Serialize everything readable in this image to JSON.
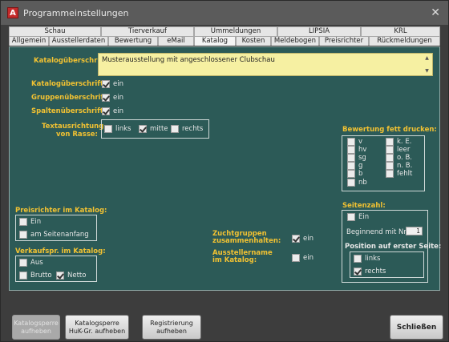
{
  "window": {
    "title": "Programmeinstellungen",
    "app_icon": "A"
  },
  "tabs_row1": [
    "Schau",
    "Tierverkauf",
    "Ummeldungen",
    "LIPSIA",
    "KRL"
  ],
  "tabs_row2": [
    "Allgemein",
    "Ausstellerdaten",
    "Bewertung",
    "eMail",
    "Katalog",
    "Kosten",
    "Meldebogen",
    "Preisrichter",
    "Rückmeldungen"
  ],
  "active_tab": "Katalog",
  "catalog": {
    "title_label": "Katalogüberschrift:",
    "title_value": "Musterausstellung mit angeschlossener Clubschau",
    "checks": [
      {
        "label": "Katalogüberschrift:",
        "opt": "ein",
        "checked": true
      },
      {
        "label": "Gruppenüberschrift:",
        "opt": "ein",
        "checked": true
      },
      {
        "label": "Spaltenüberschrift:",
        "opt": "ein",
        "checked": true
      }
    ],
    "alignment": {
      "label1": "Textausrichtung",
      "label2": "von Rasse:",
      "options": [
        {
          "text": "links",
          "checked": false
        },
        {
          "text": "mitte",
          "checked": true
        },
        {
          "text": "rechts",
          "checked": false
        }
      ]
    },
    "bold_grades": {
      "label": "Bewertung fett drucken:",
      "col1": [
        {
          "text": "v",
          "checked": false
        },
        {
          "text": "hv",
          "checked": false
        },
        {
          "text": "sg",
          "checked": false
        },
        {
          "text": "g",
          "checked": false
        },
        {
          "text": "b",
          "checked": false
        },
        {
          "text": "nb",
          "checked": false
        }
      ],
      "col2": [
        {
          "text": "k. E.",
          "checked": false
        },
        {
          "text": "leer",
          "checked": false
        },
        {
          "text": "o. B.",
          "checked": false
        },
        {
          "text": "n. B.",
          "checked": false
        },
        {
          "text": "fehlt",
          "checked": false
        }
      ]
    },
    "judges": {
      "label": "Preisrichter im Katalog:",
      "opt1": "Ein",
      "opt2": "am Seitenanfang"
    },
    "sales": {
      "label": "Verkaufspr. im Katalog:",
      "opt1": "Aus",
      "opt2": "Brutto",
      "opt3": "Netto"
    },
    "zucht": {
      "label1": "Zuchtgruppen",
      "label2": "zusammenhalten:",
      "opt": "ein",
      "checked": true
    },
    "aussteller": {
      "label1": "Ausstellername",
      "label2": "im Katalog:",
      "opt": "ein",
      "checked": false
    },
    "pagenum": {
      "label": "Seitenzahl:",
      "opt": "Ein",
      "begin_label": "Beginnend mit Nr.",
      "begin_value": "1",
      "position_label": "Position auf erster Seite:",
      "pos1": "links",
      "pos2": "rechts"
    }
  },
  "buttons": {
    "lock": "Katalogsperre aufheben",
    "lock_huk_l1": "Katalogsperre",
    "lock_huk_l2": "HuK-Gr. aufheben",
    "reg_l1": "Registrierung",
    "reg_l2": "aufheben",
    "close": "Schließen"
  },
  "colors": {
    "panel": "#2c5a57",
    "label": "#f2c232",
    "title_field": "#f6f0a2"
  }
}
